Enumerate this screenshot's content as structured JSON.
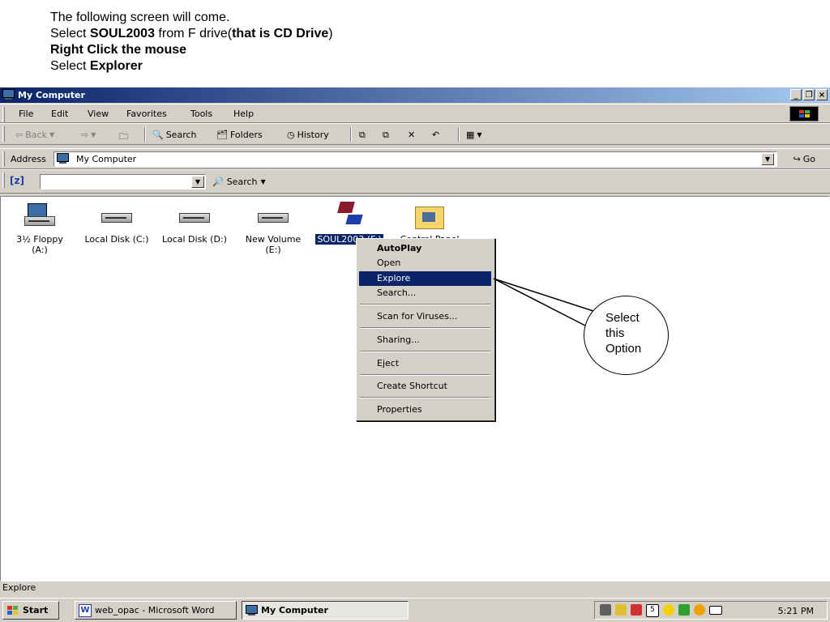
{
  "slide": {
    "line1": "The following screen will come.",
    "line2_a": "Select ",
    "line2_b": "SOUL2003",
    "line2_c": " from F drive(",
    "line2_d": "that is CD Drive",
    "line2_e": ")",
    "line3": "Right Click the mouse",
    "line4_a": "Select ",
    "line4_b": "Explorer"
  },
  "window": {
    "title": "My Computer",
    "controls": {
      "minimize": "_",
      "restore": "❐",
      "close": "×"
    }
  },
  "menu": [
    "File",
    "Edit",
    "View",
    "Favorites",
    "Tools",
    "Help"
  ],
  "toolbar": {
    "back": "Back",
    "search": "Search",
    "folders": "Folders",
    "history": "History"
  },
  "address": {
    "label": "Address",
    "value": "My Computer",
    "go": "Go"
  },
  "search_bar": {
    "badge": "[z]",
    "value": "",
    "label": "Search"
  },
  "drives": [
    {
      "label1": "3½ Floppy",
      "label2": "(A:)",
      "icon": "floppy-drive-icon"
    },
    {
      "label1": "Local Disk (C:)",
      "label2": "",
      "icon": "hard-disk-icon"
    },
    {
      "label1": "Local Disk (D:)",
      "label2": "",
      "icon": "hard-disk-icon"
    },
    {
      "label1": "New Volume",
      "label2": "(E:)",
      "icon": "hard-disk-icon"
    },
    {
      "label1": "SOUL2003 (F:)",
      "label2": "",
      "icon": "cd-drive-icon"
    },
    {
      "label1": "Control Panel",
      "label2": "",
      "icon": "control-panel-icon"
    }
  ],
  "context_menu": {
    "items": [
      "AutoPlay",
      "Open",
      "Explore",
      "Search...",
      "Scan for Viruses...",
      "Sharing...",
      "Eject",
      "Create Shortcut",
      "Properties"
    ],
    "highlighted": "Explore",
    "default": "AutoPlay"
  },
  "callout": {
    "line1": "Select",
    "line2": "this",
    "line3": "Option"
  },
  "status": {
    "text": "Explore"
  },
  "taskbar": {
    "start": "Start",
    "tasks": [
      "web_opac - Microsoft Word",
      "My Computer"
    ],
    "clock": "5:21 PM"
  },
  "colors": {
    "title_start": "#0a246a",
    "title_end": "#a6caf0",
    "selection": "#0a246a",
    "face": "#d4d0c8"
  }
}
